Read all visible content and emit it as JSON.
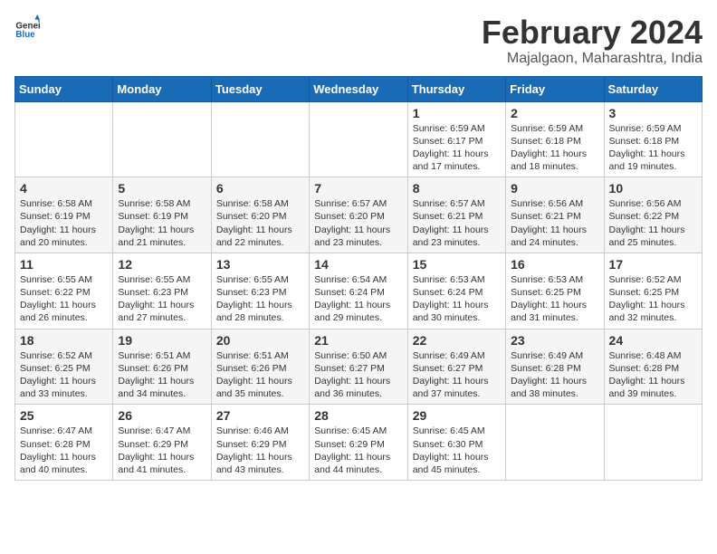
{
  "header": {
    "logo_general": "General",
    "logo_blue": "Blue",
    "title": "February 2024",
    "subtitle": "Majalgaon, Maharashtra, India"
  },
  "calendar": {
    "columns": [
      "Sunday",
      "Monday",
      "Tuesday",
      "Wednesday",
      "Thursday",
      "Friday",
      "Saturday"
    ],
    "weeks": [
      {
        "days": [
          {
            "num": "",
            "info": ""
          },
          {
            "num": "",
            "info": ""
          },
          {
            "num": "",
            "info": ""
          },
          {
            "num": "",
            "info": ""
          },
          {
            "num": "1",
            "info": "Sunrise: 6:59 AM\nSunset: 6:17 PM\nDaylight: 11 hours and 17 minutes."
          },
          {
            "num": "2",
            "info": "Sunrise: 6:59 AM\nSunset: 6:18 PM\nDaylight: 11 hours and 18 minutes."
          },
          {
            "num": "3",
            "info": "Sunrise: 6:59 AM\nSunset: 6:18 PM\nDaylight: 11 hours and 19 minutes."
          }
        ]
      },
      {
        "days": [
          {
            "num": "4",
            "info": "Sunrise: 6:58 AM\nSunset: 6:19 PM\nDaylight: 11 hours and 20 minutes."
          },
          {
            "num": "5",
            "info": "Sunrise: 6:58 AM\nSunset: 6:19 PM\nDaylight: 11 hours and 21 minutes."
          },
          {
            "num": "6",
            "info": "Sunrise: 6:58 AM\nSunset: 6:20 PM\nDaylight: 11 hours and 22 minutes."
          },
          {
            "num": "7",
            "info": "Sunrise: 6:57 AM\nSunset: 6:20 PM\nDaylight: 11 hours and 23 minutes."
          },
          {
            "num": "8",
            "info": "Sunrise: 6:57 AM\nSunset: 6:21 PM\nDaylight: 11 hours and 23 minutes."
          },
          {
            "num": "9",
            "info": "Sunrise: 6:56 AM\nSunset: 6:21 PM\nDaylight: 11 hours and 24 minutes."
          },
          {
            "num": "10",
            "info": "Sunrise: 6:56 AM\nSunset: 6:22 PM\nDaylight: 11 hours and 25 minutes."
          }
        ]
      },
      {
        "days": [
          {
            "num": "11",
            "info": "Sunrise: 6:55 AM\nSunset: 6:22 PM\nDaylight: 11 hours and 26 minutes."
          },
          {
            "num": "12",
            "info": "Sunrise: 6:55 AM\nSunset: 6:23 PM\nDaylight: 11 hours and 27 minutes."
          },
          {
            "num": "13",
            "info": "Sunrise: 6:55 AM\nSunset: 6:23 PM\nDaylight: 11 hours and 28 minutes."
          },
          {
            "num": "14",
            "info": "Sunrise: 6:54 AM\nSunset: 6:24 PM\nDaylight: 11 hours and 29 minutes."
          },
          {
            "num": "15",
            "info": "Sunrise: 6:53 AM\nSunset: 6:24 PM\nDaylight: 11 hours and 30 minutes."
          },
          {
            "num": "16",
            "info": "Sunrise: 6:53 AM\nSunset: 6:25 PM\nDaylight: 11 hours and 31 minutes."
          },
          {
            "num": "17",
            "info": "Sunrise: 6:52 AM\nSunset: 6:25 PM\nDaylight: 11 hours and 32 minutes."
          }
        ]
      },
      {
        "days": [
          {
            "num": "18",
            "info": "Sunrise: 6:52 AM\nSunset: 6:25 PM\nDaylight: 11 hours and 33 minutes."
          },
          {
            "num": "19",
            "info": "Sunrise: 6:51 AM\nSunset: 6:26 PM\nDaylight: 11 hours and 34 minutes."
          },
          {
            "num": "20",
            "info": "Sunrise: 6:51 AM\nSunset: 6:26 PM\nDaylight: 11 hours and 35 minutes."
          },
          {
            "num": "21",
            "info": "Sunrise: 6:50 AM\nSunset: 6:27 PM\nDaylight: 11 hours and 36 minutes."
          },
          {
            "num": "22",
            "info": "Sunrise: 6:49 AM\nSunset: 6:27 PM\nDaylight: 11 hours and 37 minutes."
          },
          {
            "num": "23",
            "info": "Sunrise: 6:49 AM\nSunset: 6:28 PM\nDaylight: 11 hours and 38 minutes."
          },
          {
            "num": "24",
            "info": "Sunrise: 6:48 AM\nSunset: 6:28 PM\nDaylight: 11 hours and 39 minutes."
          }
        ]
      },
      {
        "days": [
          {
            "num": "25",
            "info": "Sunrise: 6:47 AM\nSunset: 6:28 PM\nDaylight: 11 hours and 40 minutes."
          },
          {
            "num": "26",
            "info": "Sunrise: 6:47 AM\nSunset: 6:29 PM\nDaylight: 11 hours and 41 minutes."
          },
          {
            "num": "27",
            "info": "Sunrise: 6:46 AM\nSunset: 6:29 PM\nDaylight: 11 hours and 43 minutes."
          },
          {
            "num": "28",
            "info": "Sunrise: 6:45 AM\nSunset: 6:29 PM\nDaylight: 11 hours and 44 minutes."
          },
          {
            "num": "29",
            "info": "Sunrise: 6:45 AM\nSunset: 6:30 PM\nDaylight: 11 hours and 45 minutes."
          },
          {
            "num": "",
            "info": ""
          },
          {
            "num": "",
            "info": ""
          }
        ]
      }
    ]
  }
}
